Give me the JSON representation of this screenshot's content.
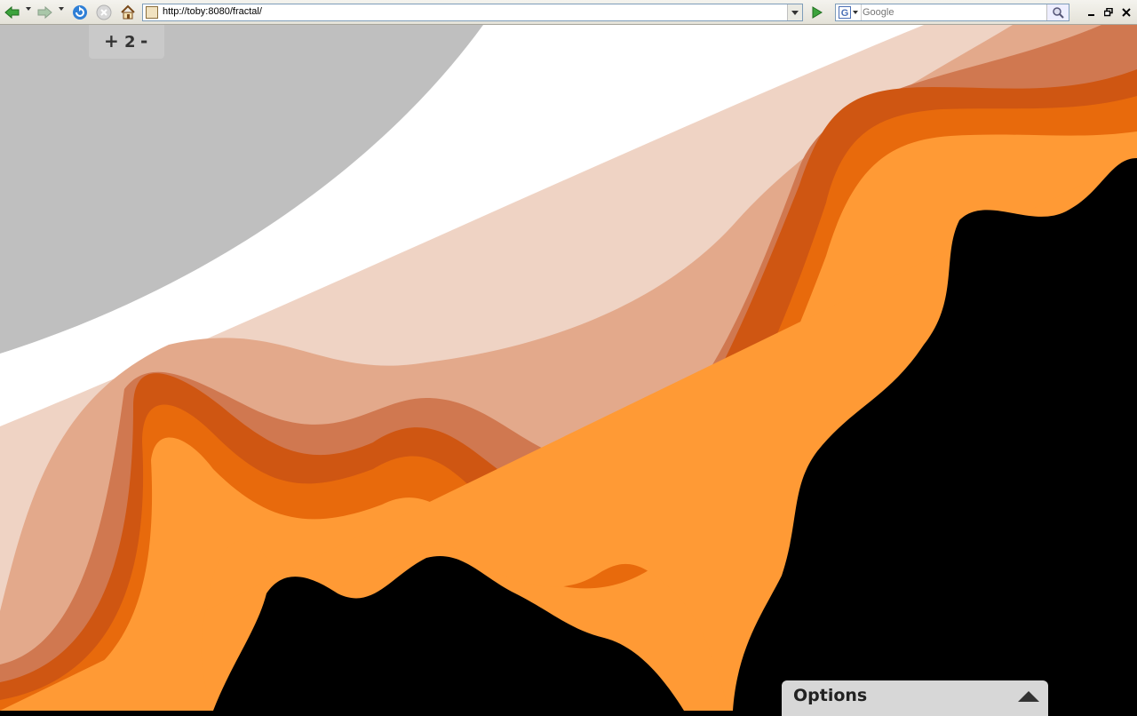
{
  "browser": {
    "url": "http://toby:8080/fractal/",
    "search_placeholder": "Google",
    "search_engine_letter": "G"
  },
  "zoom": {
    "plus": "+",
    "level": "2",
    "minus": "-"
  },
  "options": {
    "title": "Options"
  },
  "colors": {
    "set_interior": "#000000",
    "band_1": "#ffa040",
    "band_2": "#ff7010",
    "band_3": "#e05a08",
    "band_4": "#cf5612",
    "band_5": "#d07850",
    "band_6": "#e3a98b",
    "band_7": "#efd3c4",
    "band_8": "#ffffff",
    "outer": "#bfbfbf"
  },
  "icons": [
    "back-icon",
    "forward-icon",
    "refresh-icon",
    "stop-icon",
    "home-icon",
    "go-icon",
    "search-icon",
    "minimize-icon",
    "restore-icon",
    "close-icon"
  ]
}
